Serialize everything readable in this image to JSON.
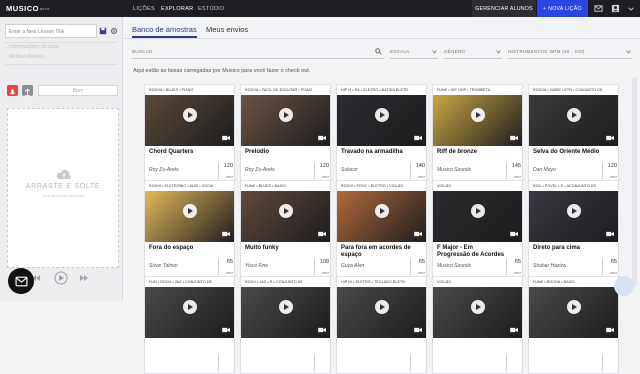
{
  "topbar": {
    "logo": "MUSICO",
    "beta": "BETA",
    "nav": [
      "LIÇÕES",
      "EXPLORAR",
      "ESTÚDIO"
    ],
    "manage_label": "GERENCIAR ALUNOS",
    "new_lesson_label": "+ NOVA LIÇÃO"
  },
  "sidebar": {
    "lesson_title_placeholder": "Enter a New Lesson Title",
    "ghost_info": "Informações de aula",
    "ghost_attrib": "Atribuir Alunos",
    "bpm_placeholder": "Bpm",
    "drop_title": "ARRASTE E SOLTE",
    "drop_sub": "Seus arquivos incluíndo"
  },
  "main": {
    "tabs": [
      "Banco de amostras",
      "Meus envios"
    ],
    "filters": [
      "BUSCAR",
      "ESCALA",
      "GÊNERO",
      "INSTRUMENTOS",
      "BPM (40 - 240)"
    ],
    "intro": "Aqui estão as faixas carregadas por Musico para você fazer o check out."
  },
  "cards": [
    {
      "tags": "ROCHA • BLUES • PIANO",
      "title": "Chord Quarters",
      "author": "Roy Zu-Arets",
      "tempo": "120",
      "unit": "BPM",
      "theme": "#5a4a3a"
    },
    {
      "tags": "ROCHA • FACIL DE ESCUTAR • PIANO",
      "title": "Prelúdio",
      "author": "Roy Zu-Arets",
      "tempo": "120",
      "unit": "BPM",
      "theme": "#6b5444"
    },
    {
      "tags": "HIP H • RA • ELETRÔ • BATIDA ELETR",
      "title": "Travado na armadilha",
      "author": "Sulocor",
      "tempo": "140",
      "unit": "BPM",
      "theme": "#2c2c30"
    },
    {
      "tags": "FUNK • HIP HOP • TROMBETA",
      "title": "Riff de bronze",
      "author": "Musico Sounds",
      "tempo": "145",
      "unit": "BPM",
      "theme": "#c9a743"
    },
    {
      "tags": "ROCHA • VARIE • ETN • CONJUNTO DE",
      "title": "Selva do Oriente Médio",
      "author": "Dan Mayo",
      "tempo": "120",
      "unit": "BPM",
      "theme": "#3a3a3a"
    },
    {
      "tags": "ROCHI • ELETRÔNIC • ALMI • VOCAI",
      "title": "Fora do espaço",
      "author": "Sivan Talmor",
      "tempo": "65",
      "unit": "BPM",
      "theme": "#e4b95a"
    },
    {
      "tags": "FUNK • BLUES • BAIXO",
      "title": "Muito funky",
      "author": "Yossi Fine",
      "tempo": "109",
      "unit": "BPM",
      "theme": "#5e4a3c"
    },
    {
      "tags": "ROCHI • POVC • ELETRÔ • VIOLÃO",
      "title": "Para fora em acordes de espaço",
      "author": "Guva Alon",
      "tempo": "65",
      "unit": "BPM",
      "theme": "#b06a3a"
    },
    {
      "tags": "VIOLÃO",
      "title": "F Major - Em Progressão de Acordes",
      "author": "Musico Sounds",
      "tempo": "65",
      "unit": "BPM",
      "theme": "#2b2b2e"
    },
    {
      "tags": "ROC • POVEL • E • ACONJUNTO DE",
      "title": "Direto para cima",
      "author": "Shahar Haziza",
      "tempo": "65",
      "unit": "BPM",
      "theme": "#3b3640"
    },
    {
      "tags": "FUN • ROCH • JAZ • CONJUNTO DE",
      "title": "",
      "author": "",
      "tempo": "",
      "unit": "",
      "theme": "#4a4a4a"
    },
    {
      "tags": "ROCH • JAZ • R • CONJUNTO DE",
      "title": "",
      "author": "",
      "tempo": "",
      "unit": "",
      "theme": "#4a4a4a"
    },
    {
      "tags": "HIP HI • ELETRÔ • TECLADO ELETR",
      "title": "",
      "author": "",
      "tempo": "",
      "unit": "",
      "theme": "#4a4a4a"
    },
    {
      "tags": "VIOLÃO",
      "title": "",
      "author": "",
      "tempo": "",
      "unit": "",
      "theme": "#4a4a4a"
    },
    {
      "tags": "FUNK • ROCHA • BAIXO",
      "title": "",
      "author": "",
      "tempo": "",
      "unit": "",
      "theme": "#4a4a4a"
    }
  ]
}
